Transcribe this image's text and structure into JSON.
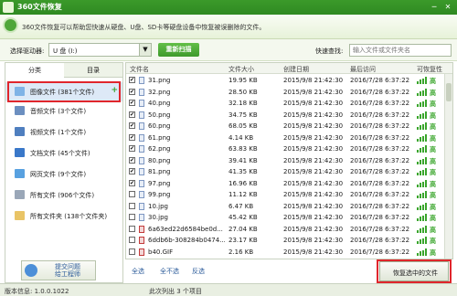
{
  "window": {
    "title": "360文件恢复",
    "minimize": "─",
    "close": "✕"
  },
  "banner": {
    "text": "360文件恢复可以帮助您快速从硬盘、U盘、SD卡等硬盘设备中恢复被误删除的文件。"
  },
  "toolbar": {
    "drive_label": "选择驱动器:",
    "drive_value": "U 盘 (I:)",
    "scan_button": "重新扫描",
    "search_label": "快速查找:",
    "search_placeholder": "输入文件或文件夹名"
  },
  "sidebar": {
    "tabs": [
      "分类",
      "目录"
    ],
    "categories": [
      {
        "label": "图像文件 (381个文件)",
        "selected": true
      },
      {
        "label": "音频文件 (3个文件)"
      },
      {
        "label": "视频文件 (1个文件)"
      },
      {
        "label": "文档文件 (45个文件)"
      },
      {
        "label": "网页文件 (9个文件)"
      },
      {
        "label": "所有文件 (906个文件)"
      },
      {
        "label": "所有文件夹 (138个文件夹)"
      }
    ],
    "feedback_line1": "提交问题",
    "feedback_line2": "给工程师"
  },
  "filelist": {
    "columns": [
      "文件名",
      "文件大小",
      "创建日期",
      "最后访问",
      "可恢复性"
    ],
    "rows": [
      {
        "checked": true,
        "name": "31.png",
        "size": "19.95 KB",
        "created": "2015/9/8 21:42:30",
        "accessed": "2016/7/28 6:37:22",
        "quality": "高"
      },
      {
        "checked": true,
        "name": "32.png",
        "size": "28.50 KB",
        "created": "2015/9/8 21:42:30",
        "accessed": "2016/7/28 6:37:22",
        "quality": "高"
      },
      {
        "checked": true,
        "name": "40.png",
        "size": "32.18 KB",
        "created": "2015/9/8 21:42:30",
        "accessed": "2016/7/28 6:37:22",
        "quality": "高"
      },
      {
        "checked": true,
        "name": "50.png",
        "size": "34.75 KB",
        "created": "2015/9/8 21:42:30",
        "accessed": "2016/7/28 6:37:22",
        "quality": "高"
      },
      {
        "checked": true,
        "name": "60.png",
        "size": "68.05 KB",
        "created": "2015/9/8 21:42:30",
        "accessed": "2016/7/28 6:37:22",
        "quality": "高"
      },
      {
        "checked": true,
        "name": "61.png",
        "size": "4.14 KB",
        "created": "2015/9/8 21:42:30",
        "accessed": "2016/7/28 6:37:22",
        "quality": "高"
      },
      {
        "checked": true,
        "name": "62.png",
        "size": "63.83 KB",
        "created": "2015/9/8 21:42:30",
        "accessed": "2016/7/28 6:37:22",
        "quality": "高"
      },
      {
        "checked": true,
        "name": "80.png",
        "size": "39.41 KB",
        "created": "2015/9/8 21:42:30",
        "accessed": "2016/7/28 6:37:22",
        "quality": "高"
      },
      {
        "checked": true,
        "name": "81.png",
        "size": "41.35 KB",
        "created": "2015/9/8 21:42:30",
        "accessed": "2016/7/28 6:37:22",
        "quality": "高"
      },
      {
        "checked": true,
        "name": "97.png",
        "size": "16.96 KB",
        "created": "2015/9/8 21:42:30",
        "accessed": "2016/7/28 6:37:22",
        "quality": "高"
      },
      {
        "checked": false,
        "name": "99.png",
        "size": "11.12 KB",
        "created": "2015/9/8 21:42:30",
        "accessed": "2016/7/28 6:37:22",
        "quality": "高"
      },
      {
        "checked": false,
        "name": "10.jpg",
        "size": "6.47 KB",
        "created": "2015/9/8 21:42:30",
        "accessed": "2016/7/28 6:37:22",
        "quality": "高"
      },
      {
        "checked": false,
        "name": "30.jpg",
        "size": "45.42 KB",
        "created": "2015/9/8 21:42:30",
        "accessed": "2016/7/28 6:37:22",
        "quality": "高"
      },
      {
        "checked": false,
        "name": "6a63ed22d6584be0d...",
        "size": "27.04 KB",
        "created": "2015/9/8 21:42:30",
        "accessed": "2016/7/28 6:37:22",
        "quality": "高"
      },
      {
        "checked": false,
        "name": "6ddb6b-308284b0474...",
        "size": "23.17 KB",
        "created": "2015/9/8 21:42:30",
        "accessed": "2016/7/28 6:37:22",
        "quality": "高"
      },
      {
        "checked": false,
        "name": "b40.GIF",
        "size": "2.16 KB",
        "created": "2015/9/8 21:42:30",
        "accessed": "2016/7/28 6:37:22",
        "quality": "高"
      }
    ]
  },
  "bottom": {
    "select_all": "全选",
    "select_none": "全不选",
    "invert": "反选",
    "recover_button": "恢复选中的文件"
  },
  "status": {
    "version": "版本信息: 1.0.0.1022",
    "listed": "此次列出 3 个项目"
  }
}
